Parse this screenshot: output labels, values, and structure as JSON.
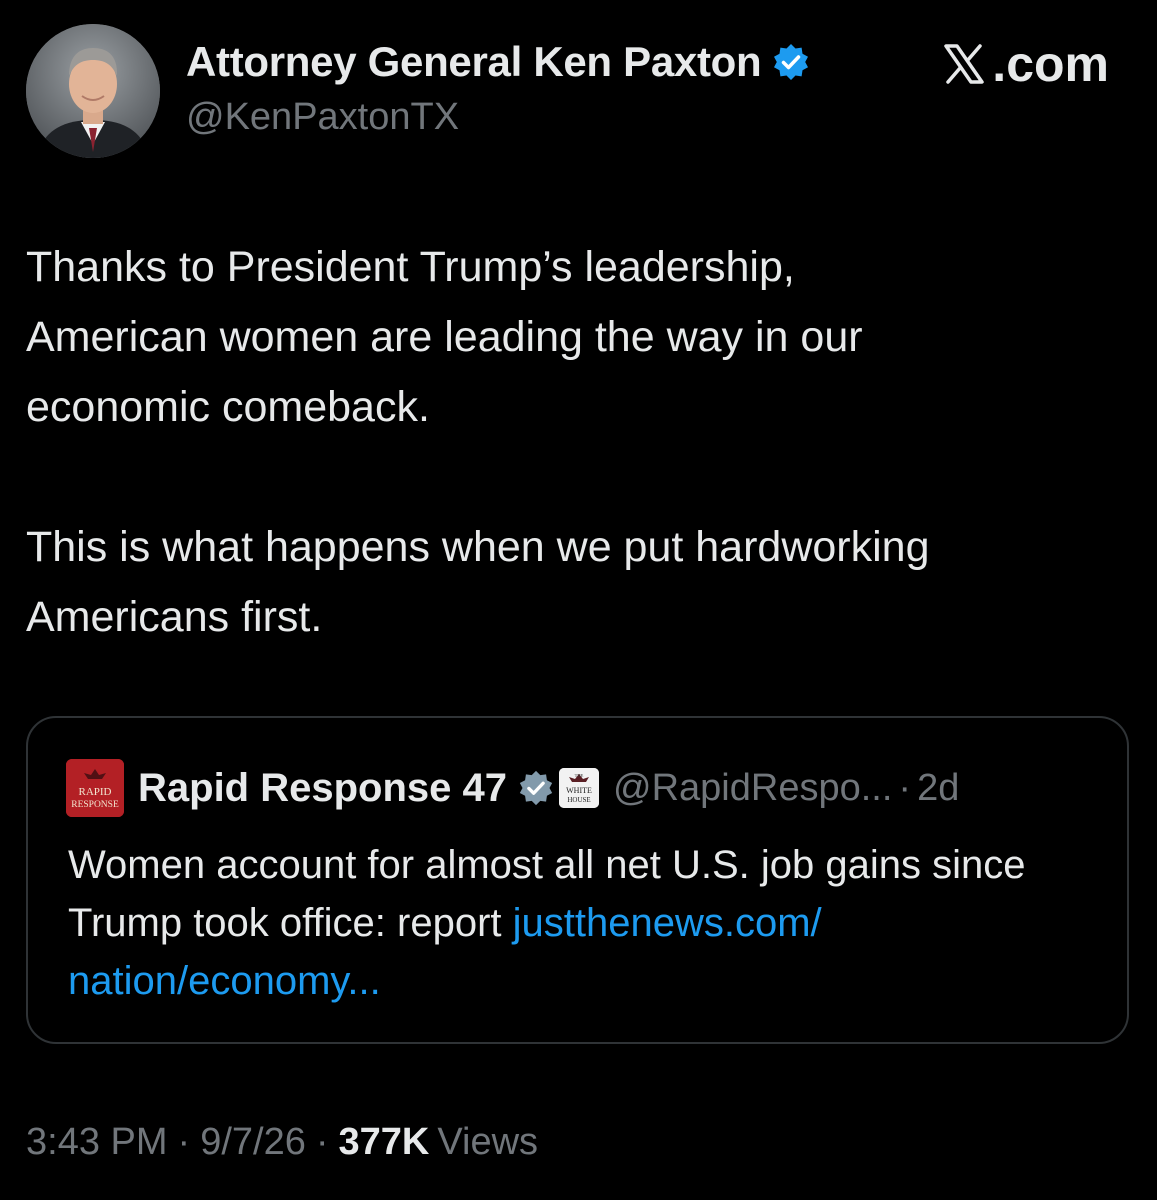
{
  "author": {
    "display_name": "Attorney General Ken Paxton",
    "handle": "@KenPaxtonTX",
    "verified_icon": "verified-badge-icon",
    "verified_color": "#1d9bf0"
  },
  "brand": {
    "text": ".com",
    "icon": "x-logo-icon"
  },
  "tweet": {
    "paragraph_1": "Thanks to President Trump’s leadership,\nAmerican women are leading the way in our\neconomic comeback.",
    "paragraph_2": "This is what happens when we put hardworking\nAmericans first."
  },
  "quote": {
    "avatar_line_1": "RAPID",
    "avatar_line_2": "RESPONSE",
    "display_name": "Rapid Response 47",
    "verified_icon": "verified-gray-badge-icon",
    "affiliate_badge_line_1": "THE",
    "affiliate_badge_line_2": "WHITE",
    "affiliate_badge_line_3": "HOUSE",
    "handle": "@RapidRespo...",
    "separator": "·",
    "time": "2d",
    "text": "Women account for almost all net U.S. job gains since Trump took office: report ",
    "link_text": "justthenews.com/\nnation/economy...",
    "link_color": "#1d9bf0"
  },
  "meta": {
    "time": "3:43 PM",
    "separator": "·",
    "date": "9/7/26",
    "views_count": "377K",
    "views_label": "Views"
  },
  "colors": {
    "background": "#000000",
    "primary_text": "#e7e9ea",
    "secondary_text": "#71767b",
    "border": "#2f3336"
  }
}
